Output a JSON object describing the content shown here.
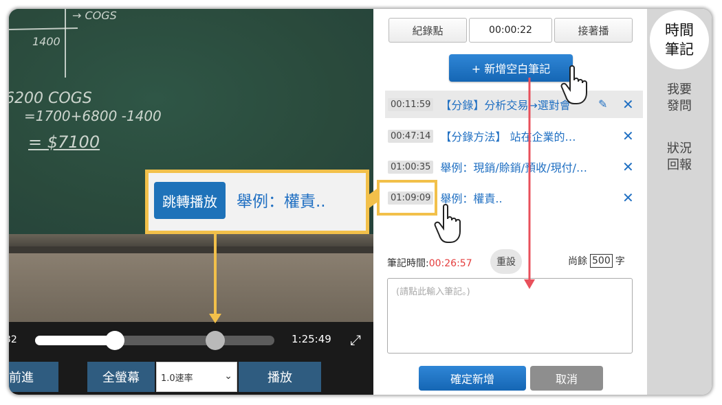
{
  "video": {
    "chalk_lines": [
      "→ COGS",
      "6200 COGS",
      "=1700+6800 -1400",
      "= $7100",
      "1400"
    ],
    "current_time_partial": "32",
    "total_time": "1:25:49",
    "buttons": {
      "forward": "前進",
      "fullscreen": "全螢幕",
      "speed": "1.0速率",
      "play": "播放"
    }
  },
  "panel": {
    "toolbar": {
      "bookmark": "紀錄點",
      "time_value": "00:00:22",
      "continue": "接著播"
    },
    "add_blank_note": "+ 新增空白筆記",
    "notes": [
      {
        "time": "00:11:59",
        "text": "【分錄】分析交易→選對會"
      },
      {
        "time": "00:47:14",
        "text": "【分錄方法】 站在企業的…"
      },
      {
        "time": "01:00:35",
        "text": "舉例：現銷/賒銷/預收/現付/…"
      },
      {
        "time": "01:09:09",
        "text": "舉例：權責.."
      }
    ],
    "note_time_label": "筆記時間:",
    "note_time_value": "00:26:57",
    "reset": "重設",
    "remaining_prefix": "尚餘",
    "remaining_count": "500",
    "remaining_suffix": "字",
    "textarea_placeholder": "(請點此輸入筆記。)",
    "confirm": "確定新增",
    "cancel": "取消"
  },
  "side_tabs": {
    "active": "時間\n筆記",
    "ask": "我要\n發問",
    "report": "狀況\n回報"
  },
  "callout": {
    "jump_button": "跳轉播放",
    "note_text": "舉例：權責.."
  },
  "colors": {
    "accent_blue": "#1f6fc2",
    "highlight_yellow": "#f2c04a",
    "arrow_red": "#e8505b",
    "time_red": "#e43c3c"
  }
}
